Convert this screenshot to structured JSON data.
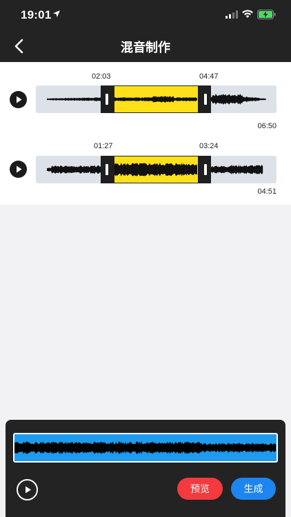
{
  "status_bar": {
    "time": "19:01",
    "location_icon": "location-arrow-icon",
    "signal_icon": "cellular-signal-icon",
    "wifi_icon": "wifi-icon",
    "battery_icon": "battery-charging-icon"
  },
  "nav": {
    "back_icon": "chevron-left-icon",
    "title": "混音制作"
  },
  "tracks": [
    {
      "selection_start": "02:03",
      "selection_end": "04:47",
      "total_duration": "06:50",
      "selection_fraction": [
        0.3,
        0.69
      ]
    },
    {
      "selection_start": "01:27",
      "selection_end": "03:24",
      "total_duration": "04:51",
      "selection_fraction": [
        0.3,
        0.7
      ]
    }
  ],
  "bottom": {
    "play_icon": "play-icon",
    "preview_label": "预览",
    "generate_label": "生成"
  },
  "colors": {
    "header_bg": "#232323",
    "selection_yellow": "#ffe11b",
    "mix_wave_blue": "#1e9bef",
    "preview_red": "#f33a3e",
    "generate_blue": "#1d85ef"
  }
}
